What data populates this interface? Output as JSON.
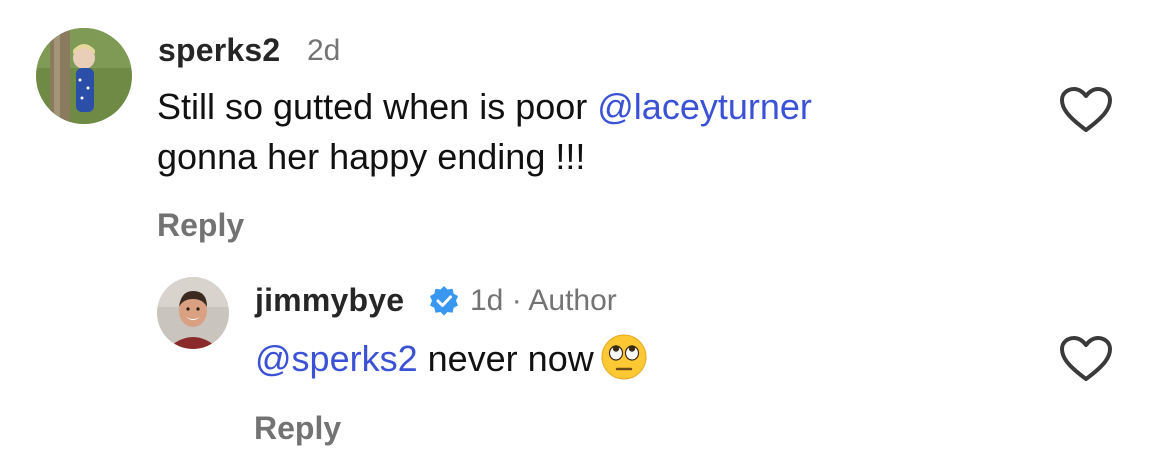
{
  "comment": {
    "username": "sperks2",
    "time": "2d",
    "text_line1_before": "Still so gutted when is poor ",
    "mention": "@laceyturner",
    "text_line2": "gonna her happy ending !!!",
    "reply_label": "Reply",
    "like_icon": "heart-outline-icon",
    "avatar_icon": "user-avatar"
  },
  "reply": {
    "username": "jimmybye",
    "verified_icon": "verified-badge-icon",
    "verified_color": "#3897f0",
    "time": "1d",
    "separator": "·",
    "author_tag": "Author",
    "mention": "@sperks2",
    "text": " never now",
    "emoji": "face-with-rolling-eyes",
    "reply_label": "Reply",
    "like_icon": "heart-outline-icon",
    "avatar_icon": "user-avatar"
  },
  "colors": {
    "mention": "#3b52d6",
    "muted": "#737373",
    "text": "#111111"
  }
}
